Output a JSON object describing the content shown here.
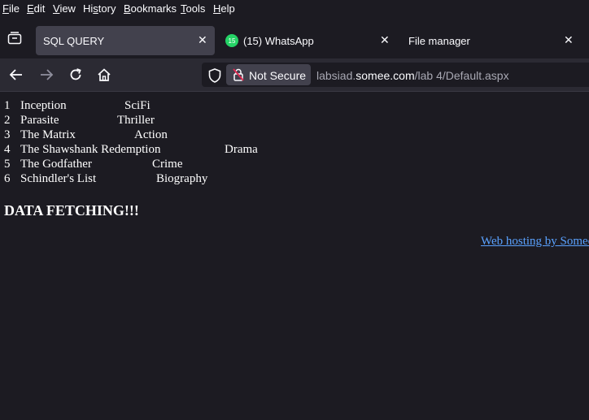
{
  "menu": {
    "file": {
      "key": "F",
      "rest": "ile"
    },
    "edit": {
      "key": "E",
      "rest": "dit"
    },
    "view": {
      "key": "V",
      "rest": "iew"
    },
    "history": {
      "pre": "Hi",
      "key": "s",
      "rest": "tory"
    },
    "bookmarks": {
      "key": "B",
      "rest": "ookmarks"
    },
    "tools": {
      "key": "T",
      "rest": "ools"
    },
    "help": {
      "key": "H",
      "rest": "elp"
    }
  },
  "tabs": [
    {
      "label": "SQL QUERY",
      "active": true
    },
    {
      "label": "(15) WhatsApp",
      "badge": "15"
    },
    {
      "label": "File manager"
    }
  ],
  "close_glyph": "✕",
  "urlbar": {
    "security_label": "Not Secure",
    "url_prefix": "labsiad.",
    "url_host": "somee.com",
    "url_path": "/lab 4/Default.aspx"
  },
  "movies": [
    {
      "id": "1",
      "title": "Inception",
      "genre": "SciFi"
    },
    {
      "id": "2",
      "title": "Parasite",
      "genre": "Thriller"
    },
    {
      "id": "3",
      "title": "The Matrix",
      "genre": "Action"
    },
    {
      "id": "4",
      "title": "The Shawshank Redemption",
      "genre": "Drama"
    },
    {
      "id": "5",
      "title": "The Godfather",
      "genre": "Crime"
    },
    {
      "id": "6",
      "title": "Schindler's List",
      "genre": "Biography"
    }
  ],
  "heading": "DATA FETCHING!!!",
  "hosting_link": "Web hosting by Somee.com",
  "colors": {
    "accent_link": "#5aa2ff",
    "whatsapp_green": "#25d366",
    "background": "#1c1b22"
  }
}
